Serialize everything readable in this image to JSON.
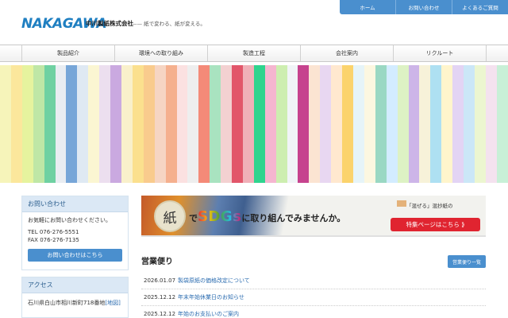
{
  "header": {
    "logo_text": "NAKAGAWA",
    "company_name": "中川製紙株式会社",
    "tagline": "—— 紙で変わる、紙が変える。"
  },
  "top_nav": [
    {
      "label": "ホーム"
    },
    {
      "label": "お問い合わせ"
    },
    {
      "label": "よくあるご質問"
    }
  ],
  "main_nav": [
    {
      "label": "製品紹介"
    },
    {
      "label": "環境への取り組み"
    },
    {
      "label": "製造工程"
    },
    {
      "label": "会社案内"
    },
    {
      "label": "リクルート"
    }
  ],
  "hero_stripe_colors": [
    "#f6f4ba",
    "#fbe79c",
    "#e6f39e",
    "#bfe7a6",
    "#6fd1a2",
    "#e9edf2",
    "#77a6d8",
    "#dfe9f3",
    "#fbf6d2",
    "#ecdfef",
    "#caa9e0",
    "#f9f0cb",
    "#fbe08e",
    "#f9cb8d",
    "#f6d5c3",
    "#f5b08e",
    "#fbe1e1",
    "#eeeeee",
    "#f48a78",
    "#a9e3c0",
    "#f3d1d1",
    "#e2566a",
    "#f0b0b8",
    "#2fd48e",
    "#f5b6d0",
    "#cdeeb0",
    "#f0f4f7",
    "#c6438e",
    "#fbe4d2",
    "#e8d7f1",
    "#ffe8cf",
    "#fbd36c",
    "#e6f4f8",
    "#fcf7e0",
    "#9ad8c3",
    "#d3ecff",
    "#ddf2c4",
    "#cdb5e8",
    "#f7f2d9",
    "#aee0f2",
    "#fff5cc",
    "#e3d4f4",
    "#cbe7f7",
    "#ecf6d0",
    "#f4e2ef",
    "#c8f0d7"
  ],
  "sidebar": {
    "contact": {
      "title": "お問い合わせ",
      "text": "お気軽にお問い合わせください。",
      "tel": "TEL 076-276-5551",
      "fax": "FAX 076-276-7135",
      "button_label": "お問い合わせはこちら"
    },
    "access": {
      "title": "アクセス",
      "address": "石川県白山市相川新町718番地",
      "map_link": "[地図]"
    }
  },
  "banner": {
    "kami_char": "紙",
    "text_prefix": "で",
    "text_sdgs": "SDGs",
    "text_suffix": "に取り組んでみませんか。",
    "caption": "「混ぜる」混抄紙の",
    "button_label": "特集ページはこちら ⟫"
  },
  "news": {
    "title": "営業便り",
    "all_button": "営業便り一覧",
    "items": [
      {
        "date": "2026.01.07",
        "title": "製袋原紙の価格改定について"
      },
      {
        "date": "2025.12.12",
        "title": "年末年始休業日のお知らせ"
      },
      {
        "date": "2025.12.12",
        "title": "年始のお支払いのご案内"
      }
    ]
  },
  "colors": {
    "accent_blue": "#4a8fce",
    "logo_blue": "#1f7fc1",
    "banner_red": "#e02430",
    "sidebar_head_bg": "#dbe8f5"
  }
}
